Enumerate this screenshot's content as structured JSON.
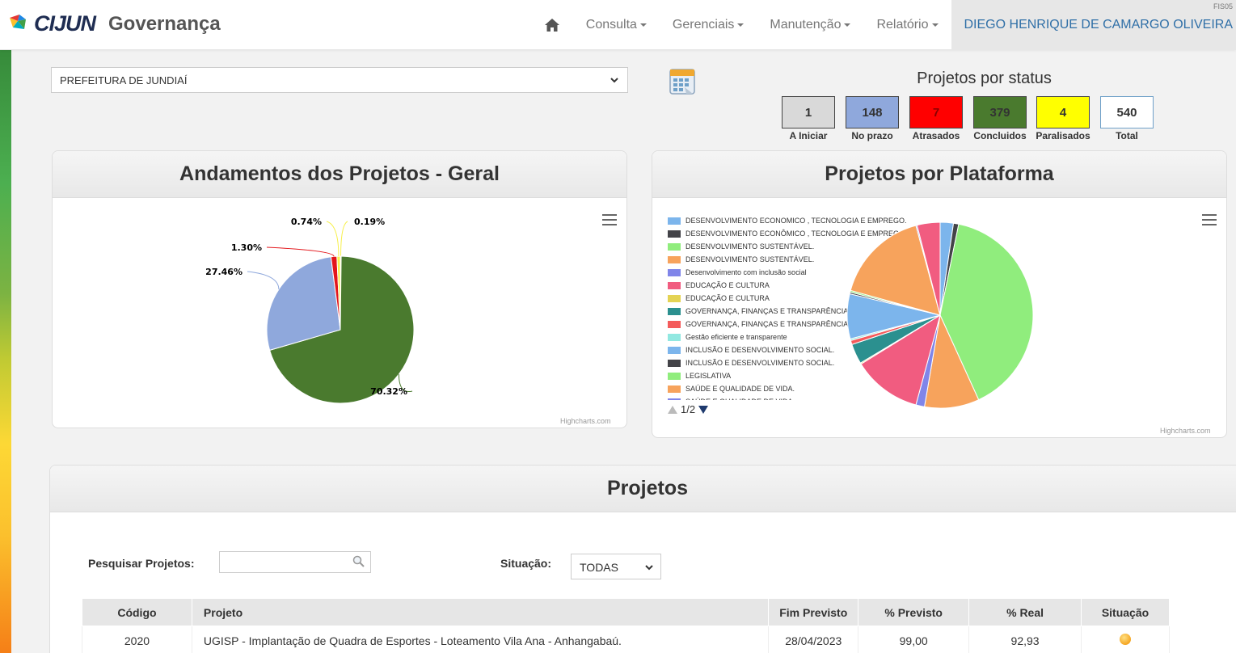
{
  "app": {
    "brand": "CIJUN",
    "title": "Governança"
  },
  "nav": {
    "home_icon": "home-icon",
    "items": [
      {
        "label": "Consulta"
      },
      {
        "label": "Gerenciais"
      },
      {
        "label": "Manutenção"
      },
      {
        "label": "Relatório"
      }
    ],
    "user": "DIEGO HENRIQUE DE CAMARGO OLIVEIRA",
    "user_code": "FIS05"
  },
  "filters": {
    "entity": "PREFEITURA DE JUNDIAÍ"
  },
  "status": {
    "title": "Projetos por status",
    "items": [
      {
        "value": "1",
        "label": "A Iniciar",
        "color": "#d9d9d9"
      },
      {
        "value": "148",
        "label": "No prazo",
        "color": "#8fa8dc"
      },
      {
        "value": "7",
        "label": "Atrasados",
        "color": "#ff0000"
      },
      {
        "value": "379",
        "label": "Concluidos",
        "color": "#4a7a2e"
      },
      {
        "value": "4",
        "label": "Paralisados",
        "color": "#ffff00"
      },
      {
        "value": "540",
        "label": "Total",
        "color": "#ffffff"
      }
    ]
  },
  "chart_general": {
    "title": "Andamentos dos Projetos - Geral",
    "credit": "Highcharts.com"
  },
  "chart_platform": {
    "title": "Projetos por Plataforma",
    "credit": "Highcharts.com",
    "pager": "1/2"
  },
  "chart_data": [
    {
      "type": "pie",
      "title": "Andamentos dos Projetos - Geral",
      "slices": [
        {
          "label": "0.19%",
          "value": 0.19,
          "color": "#f7f04a"
        },
        {
          "label": "70.32%",
          "value": 70.32,
          "color": "#4a7a2e"
        },
        {
          "label": "27.46%",
          "value": 27.46,
          "color": "#8fa8dc"
        },
        {
          "label": "1.30%",
          "value": 1.3,
          "color": "#e3161b"
        },
        {
          "label": "0.74%",
          "value": 0.74,
          "color": "#f7f04a"
        }
      ]
    },
    {
      "type": "pie",
      "title": "Projetos por Plataforma",
      "legend_position": "left",
      "legend": [
        {
          "name": "DESENVOLVIMENTO ECONOMICO , TECNOLOGIA E EMPREGO.",
          "color": "#7cb5ec"
        },
        {
          "name": "DESENVOLVIMENTO ECONÔMICO , TECNOLOGIA E EMPREGO.",
          "color": "#434348"
        },
        {
          "name": "DESENVOLVIMENTO SUSTENTÁVEL.",
          "color": "#90ed7d"
        },
        {
          "name": "DESENVOLVIMENTO SUSTENTÁVEL.",
          "color": "#f7a35c"
        },
        {
          "name": "Desenvolvimento com inclusão social",
          "color": "#8085e9"
        },
        {
          "name": "EDUCAÇÃO E CULTURA",
          "color": "#f15c80"
        },
        {
          "name": "EDUCAÇÃO E CULTURA",
          "color": "#e4d354"
        },
        {
          "name": "GOVERNANÇA, FINANÇAS E TRANSPARÊNCIA.",
          "color": "#2b908f"
        },
        {
          "name": "GOVERNANÇA, FINANÇAS E TRANSPARÊNCIA.",
          "color": "#f45b5b"
        },
        {
          "name": "Gestão eficiente e transparente",
          "color": "#91e8e1"
        },
        {
          "name": "INCLUSÃO E DESENVOLVIMENTO SOCIAL.",
          "color": "#7cb5ec"
        },
        {
          "name": "INCLUSÃO E DESENVOLVIMENTO SOCIAL.",
          "color": "#434348"
        },
        {
          "name": "LEGISLATIVA",
          "color": "#90ed7d"
        },
        {
          "name": "SAÚDE E QUALIDADE DE VIDA.",
          "color": "#f7a35c"
        },
        {
          "name": "SAÚDE E QUALIDADE DE VIDA.",
          "color": "#8085e9"
        }
      ],
      "slices": [
        {
          "value": 2.3,
          "color": "#7cb5ec"
        },
        {
          "value": 0.9,
          "color": "#434348"
        },
        {
          "value": 40.0,
          "color": "#90ed7d"
        },
        {
          "value": 9.5,
          "color": "#f7a35c"
        },
        {
          "value": 1.5,
          "color": "#8085e9"
        },
        {
          "value": 12.0,
          "color": "#f15c80"
        },
        {
          "value": 0.2,
          "color": "#e4d354"
        },
        {
          "value": 3.5,
          "color": "#2b908f"
        },
        {
          "value": 0.7,
          "color": "#f45b5b"
        },
        {
          "value": 0.3,
          "color": "#91e8e1"
        },
        {
          "value": 7.8,
          "color": "#7cb5ec"
        },
        {
          "value": 0.3,
          "color": "#434348"
        },
        {
          "value": 0.3,
          "color": "#90ed7d"
        },
        {
          "value": 16.5,
          "color": "#f7a35c"
        },
        {
          "value": 0.2,
          "color": "#8085e9"
        },
        {
          "value": 4.0,
          "color": "#f15c80"
        }
      ]
    }
  ],
  "projects": {
    "title": "Projetos",
    "search_label": "Pesquisar Projetos:",
    "search_value": "",
    "situation_label": "Situação:",
    "situation_value": "TODAS",
    "columns": [
      "Código",
      "Projeto",
      "Fim Previsto",
      "% Previsto",
      "% Real",
      "Situação"
    ],
    "rows": [
      {
        "code": "2020",
        "project": "UGISP - Implantação de Quadra de Esportes - Loteamento Vila Ana - Anhangabaú.",
        "end": "28/04/2023",
        "planned": "99,00",
        "real": "92,93",
        "status_color": "#f5a623"
      }
    ]
  }
}
